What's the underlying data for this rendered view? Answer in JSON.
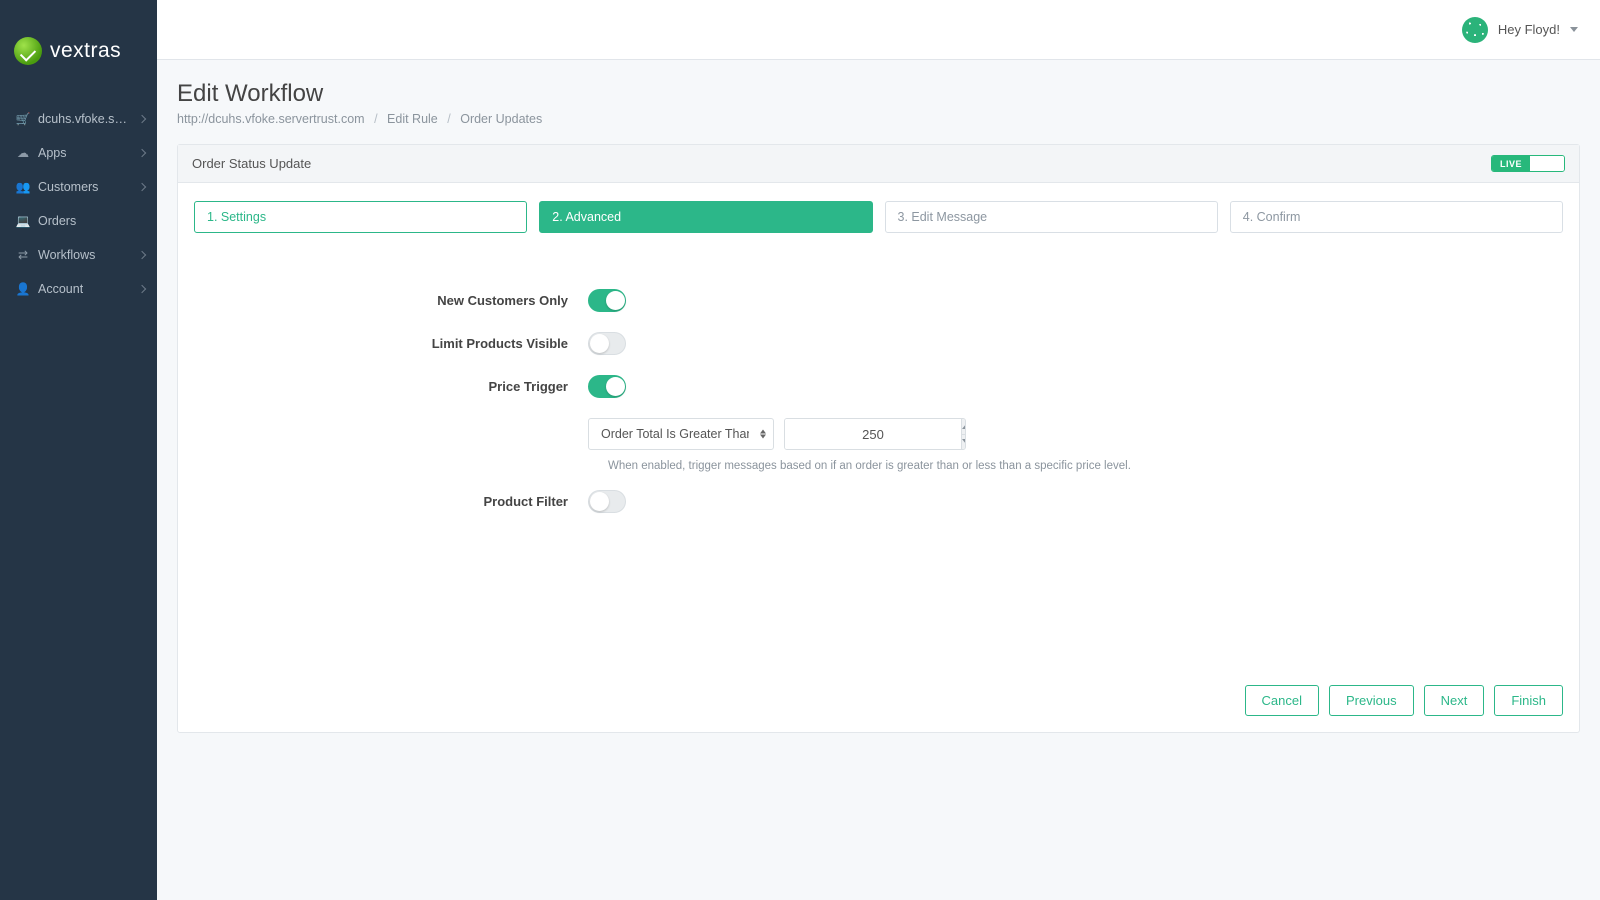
{
  "brand": "vextras",
  "user_greeting": "Hey Floyd!",
  "sidebar": {
    "items": [
      {
        "label": "dcuhs.vfoke.ser...",
        "icon": "cart"
      },
      {
        "label": "Apps",
        "icon": "cloud"
      },
      {
        "label": "Customers",
        "icon": "users"
      },
      {
        "label": "Orders",
        "icon": "laptop"
      },
      {
        "label": "Workflows",
        "icon": "shuffle"
      },
      {
        "label": "Account",
        "icon": "user"
      }
    ]
  },
  "page": {
    "title": "Edit Workflow",
    "breadcrumbs": [
      "http://dcuhs.vfoke.servertrust.com",
      "Edit Rule",
      "Order Updates"
    ]
  },
  "panel": {
    "title": "Order Status Update",
    "live_label": "LIVE",
    "steps": [
      "1. Settings",
      "2. Advanced",
      "3. Edit Message",
      "4. Confirm"
    ],
    "active_step_index": 1
  },
  "form": {
    "new_customers_label": "New Customers Only",
    "new_customers_on": true,
    "limit_products_label": "Limit Products Visible",
    "limit_products_on": false,
    "price_trigger_label": "Price Trigger",
    "price_trigger_on": true,
    "price_condition_options": [
      "Order Total Is Greater Than"
    ],
    "price_condition_selected": "Order Total Is Greater Than",
    "price_value": "250",
    "price_help": "When enabled, trigger messages based on if an order is greater than or less than a specific price level.",
    "product_filter_label": "Product Filter",
    "product_filter_on": false
  },
  "buttons": {
    "cancel": "Cancel",
    "previous": "Previous",
    "next": "Next",
    "finish": "Finish"
  }
}
